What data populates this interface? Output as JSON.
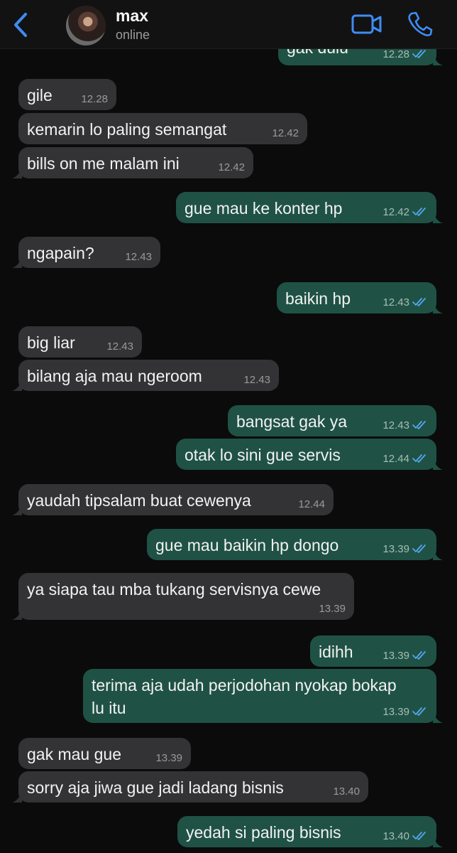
{
  "header": {
    "contact_name": "max",
    "status": "online",
    "back_icon": "chevron-left-icon",
    "video_icon": "video-camera-icon",
    "call_icon": "phone-icon",
    "accent_color": "#3f8cf4"
  },
  "colors": {
    "background": "#0b0b0b",
    "incoming_bubble": "#333335",
    "outgoing_bubble": "#1f5244",
    "read_ticks": "#53a6f0"
  },
  "messages": [
    {
      "dir": "out",
      "text": "gak dulu",
      "time": "12.28",
      "read": true
    },
    {
      "dir": "in",
      "text": "gile",
      "time": "12.28"
    },
    {
      "dir": "in",
      "text": "kemarin lo paling semangat",
      "time": "12.42"
    },
    {
      "dir": "in",
      "text": "bills on me malam ini",
      "time": "12.42"
    },
    {
      "dir": "out",
      "text": "gue mau ke konter hp",
      "time": "12.42",
      "read": true
    },
    {
      "dir": "in",
      "text": "ngapain?",
      "time": "12.43"
    },
    {
      "dir": "out",
      "text": "baikin hp",
      "time": "12.43",
      "read": true
    },
    {
      "dir": "in",
      "text": "big liar",
      "time": "12.43"
    },
    {
      "dir": "in",
      "text": "bilang aja mau ngeroom",
      "time": "12.43"
    },
    {
      "dir": "out",
      "text": "bangsat gak ya",
      "time": "12.43",
      "read": true
    },
    {
      "dir": "out",
      "text": "otak lo sini gue servis",
      "time": "12.44",
      "read": true
    },
    {
      "dir": "in",
      "text": "yaudah tipsalam buat cewenya",
      "time": "12.44"
    },
    {
      "dir": "out",
      "text": "gue mau baikin hp dongo",
      "time": "13.39",
      "read": true
    },
    {
      "dir": "in",
      "text": "ya siapa tau mba tukang servisnya cewe",
      "time": "13.39"
    },
    {
      "dir": "out",
      "text": "idihh",
      "time": "13.39",
      "read": true
    },
    {
      "dir": "out",
      "text": "terima aja udah perjodohan nyokap bokap\nlu itu",
      "time": "13.39",
      "read": true
    },
    {
      "dir": "in",
      "text": "gak mau gue",
      "time": "13.39"
    },
    {
      "dir": "in",
      "text": "sorry aja jiwa gue jadi ladang bisnis",
      "time": "13.40"
    },
    {
      "dir": "out",
      "text": "yedah si paling bisnis",
      "time": "13.40",
      "read": true
    }
  ]
}
